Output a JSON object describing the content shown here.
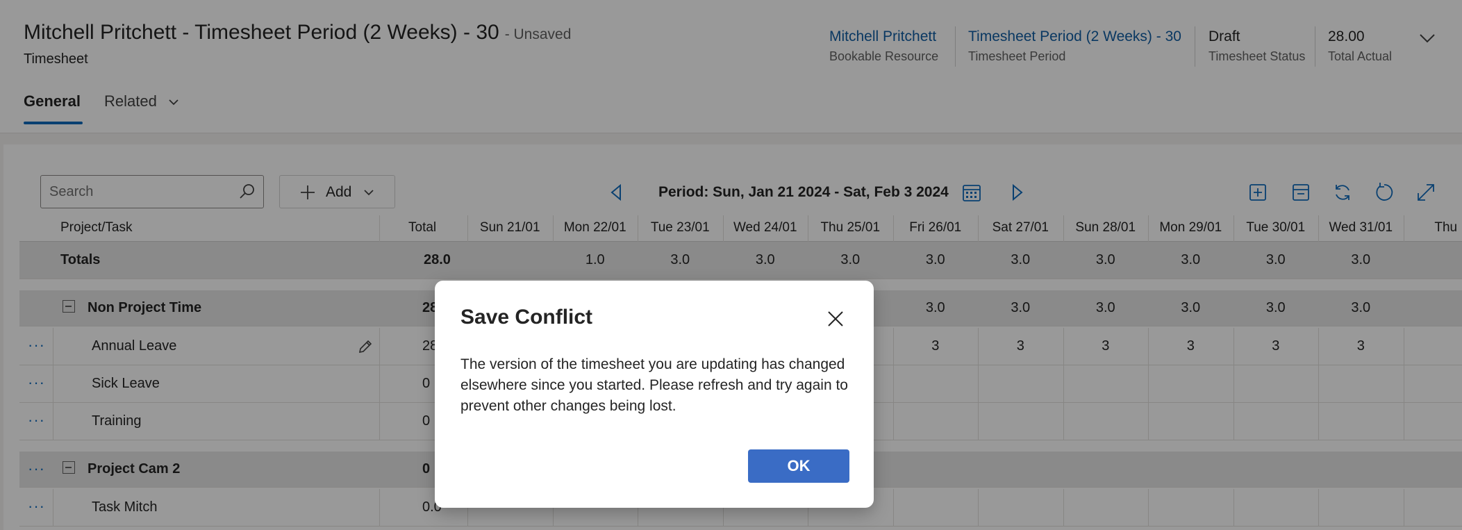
{
  "header": {
    "title": "Mitchell Pritchett - Timesheet Period (2 Weeks) - 30",
    "unsaved": "- Unsaved",
    "entity": "Timesheet",
    "fields": [
      {
        "value": "Mitchell Pritchett",
        "label": "Bookable Resource",
        "link": true
      },
      {
        "value": "Timesheet Period (2 Weeks) - 30",
        "label": "Timesheet Period",
        "link": true
      },
      {
        "value": "Draft",
        "label": "Timesheet Status",
        "link": false
      },
      {
        "value": "28.00",
        "label": "Total Actual",
        "link": false
      }
    ]
  },
  "tabs": {
    "general": "General",
    "related": "Related"
  },
  "toolbar": {
    "search_placeholder": "Search",
    "add_label": "Add",
    "period": "Period: Sun, Jan 21 2024 - Sat, Feb 3 2024"
  },
  "grid": {
    "col_project": "Project/Task",
    "col_total": "Total",
    "days": [
      "Sun 21/01",
      "Mon 22/01",
      "Tue 23/01",
      "Wed 24/01",
      "Thu 25/01",
      "Fri 26/01",
      "Sat 27/01",
      "Sun 28/01",
      "Mon 29/01",
      "Tue 30/01",
      "Wed 31/01",
      "Thu"
    ],
    "totals": {
      "label": "Totals",
      "total": "28.0",
      "days": [
        "",
        "1.0",
        "3.0",
        "3.0",
        "3.0",
        "3.0",
        "3.0",
        "3.0",
        "3.0",
        "3.0",
        "3.0",
        ""
      ]
    },
    "groups": [
      {
        "name": "Non Project Time",
        "total": "28",
        "days": [
          "",
          "",
          "",
          "",
          "",
          "3.0",
          "3.0",
          "3.0",
          "3.0",
          "3.0",
          "3.0",
          ""
        ],
        "tasks": [
          {
            "name": "Annual Leave",
            "total": "28",
            "days": [
              "",
              "",
              "",
              "",
              "",
              "3",
              "3",
              "3",
              "3",
              "3",
              "3",
              ""
            ]
          },
          {
            "name": "Sick Leave",
            "total": "0",
            "days": []
          },
          {
            "name": "Training",
            "total": "0",
            "days": []
          }
        ]
      },
      {
        "name": "Project Cam 2",
        "total": "0",
        "days": [],
        "tasks": [
          {
            "name": "Task Mitch",
            "total": "0.0",
            "days": []
          }
        ]
      }
    ]
  },
  "dialog": {
    "title": "Save Conflict",
    "message": "The version of the timesheet you are updating has changed elsewhere since you started. Please refresh and try again to prevent other changes being lost.",
    "ok_label": "OK"
  },
  "colors": {
    "accent": "#0f6cbd",
    "link": "#115ea3",
    "ok_button": "#3a6cc5"
  }
}
